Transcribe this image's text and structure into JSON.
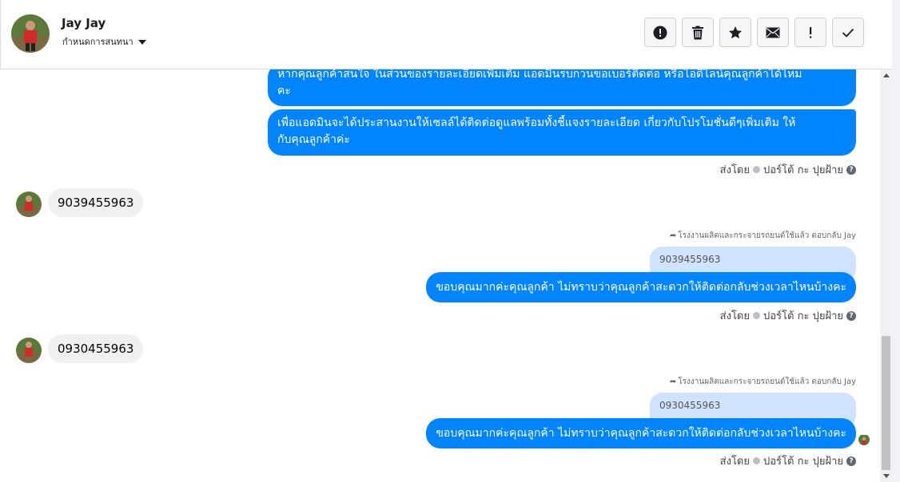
{
  "header": {
    "contact_name": "Jay Jay",
    "subtitle": "กำหนดการสนทนา",
    "toolbar": [
      {
        "name": "report-icon",
        "label": "Report"
      },
      {
        "name": "trash-icon",
        "label": "Delete"
      },
      {
        "name": "star-icon",
        "label": "Star"
      },
      {
        "name": "mail-icon",
        "label": "Mark unread"
      },
      {
        "name": "exclamation-icon",
        "label": "Spam"
      },
      {
        "name": "check-icon",
        "label": "Done"
      }
    ]
  },
  "messages": {
    "m1": {
      "line1": "หากคุณลูกค้าสนใจ ในส่วนของรายละเอียดเพิ่มเติม แอดมินรบกวนขอเบอร์ติดต่อ หรือไอดีไลน์คุณลูกค้าได้ไหม",
      "line2": "คะ"
    },
    "m2": {
      "line1": "เพื่อแอดมินจะได้ประสานงานให้เซลล์ได้ติดต่อดูแลพร้อมทั้งชี้แจงรายละเอียด เกี่ยวกับโปรโมชั่นดีๆเพิ่มเติม ให้",
      "line2": "กับคุณลูกค้าค่ะ"
    },
    "sent_by_1": "ส่งโดย",
    "sender_1": "ปอร์โต้ กะ ปุยฝ้าย",
    "in1": "9039455963",
    "reply_note_1": "โรงงานผลิตและกระจายรถยนต์ใช้แล้ว ตอบกลับ Jay",
    "quote_1": "9039455963",
    "out_1": "ขอบคุณมากค่ะคุณลูกค้า ไม่ทราบว่าคุณลูกค้าสะดวกให้ติดต่อกลับช่วงเวลาไหนบ้างคะ",
    "sent_by_2": "ส่งโดย",
    "sender_2": "ปอร์โต้ กะ ปุยฝ้าย",
    "in2": "0930455963",
    "reply_note_2": "โรงงานผลิตและกระจายรถยนต์ใช้แล้ว ตอบกลับ Jay",
    "quote_2": "0930455963",
    "out_2": "ขอบคุณมากค่ะคุณลูกค้า ไม่ทราบว่าคุณลูกค้าสะดวกให้ติดต่อกลับช่วงเวลาไหนบ้างคะ",
    "sent_by_3": "ส่งโดย",
    "sender_3": "ปอร์โต้ กะ ปุยฝ้าย"
  },
  "colors": {
    "outgoing_bubble": "#0084ff",
    "incoming_bubble": "#f0f0f0",
    "quoted_bubble": "#cfe3ff"
  }
}
